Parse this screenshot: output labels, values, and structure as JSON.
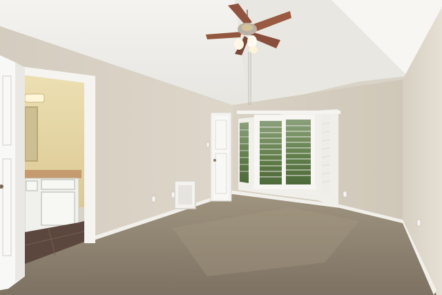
{
  "image": {
    "kind": "photograph",
    "subject": "empty-bedroom-interior",
    "icons": [
      "ceiling-fan-icon",
      "light-fixture-icon",
      "outlet-icon"
    ]
  },
  "colors": {
    "ceiling": "#f2f1ee",
    "ceiling_shadow": "#dcdad5",
    "wall_left": "#d8d1c4",
    "wall_back": "#d2cbbd",
    "wall_right": "#ddd7cb",
    "carpet": "#8b7f6f",
    "carpet_light": "#a1957f",
    "trim": "#f6f5f1",
    "door": "#f8f8f6",
    "bathroom_wall": "#e6d7a4",
    "vanity": "#eeeeea",
    "tile": "#5a463d",
    "fan_blade": "#9a5a42",
    "glass": "#6f8f5a"
  }
}
